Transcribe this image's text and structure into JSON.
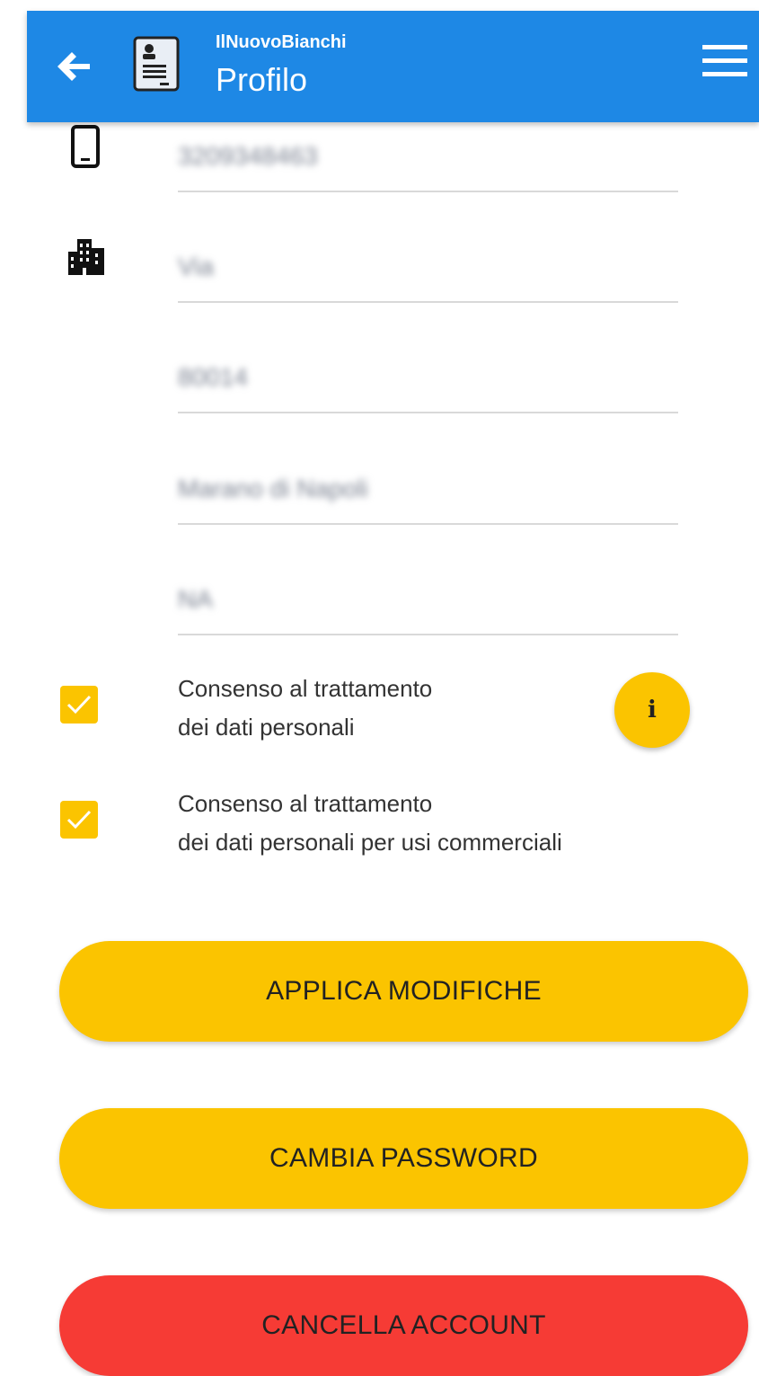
{
  "appbar": {
    "app_name": "IlNuovoBianchi",
    "title": "Profilo",
    "color": "#1e88e5",
    "icons": [
      "back-arrow-icon",
      "contact-card-icon",
      "hamburger-menu-icon"
    ]
  },
  "fields": {
    "phone": {
      "icon": "smartphone-icon",
      "value": "3209348463"
    },
    "address": {
      "icon": "city-buildings-icon",
      "value": "Via"
    },
    "cap": {
      "value": "80014"
    },
    "city": {
      "value": "Marano di Napoli"
    },
    "province": {
      "value": "NA"
    }
  },
  "consents": {
    "personal_data": {
      "line1": "Consenso al trattamento",
      "line2": "dei dati personali",
      "checked": true
    },
    "commercial": {
      "line1": "Consenso al trattamento",
      "line2": "dei dati personali per usi commerciali",
      "checked": true
    },
    "info_icon": "info-icon"
  },
  "buttons": {
    "apply": "APPLICA MODIFICHE",
    "change_password": "CAMBIA PASSWORD",
    "delete_account": "CANCELLA ACCOUNT"
  },
  "colors": {
    "accent": "#fbc400",
    "danger": "#f63b35"
  }
}
